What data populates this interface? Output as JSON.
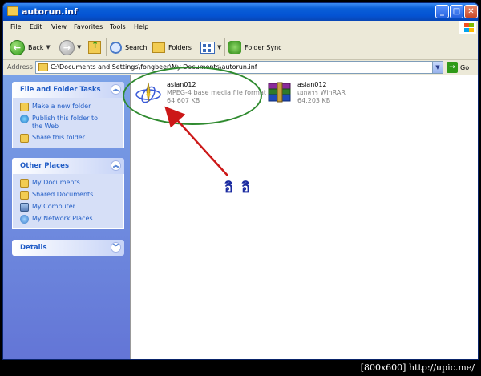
{
  "window": {
    "title": "autorun.inf"
  },
  "menu": [
    "File",
    "Edit",
    "View",
    "Favorites",
    "Tools",
    "Help"
  ],
  "toolbar": {
    "back": "Back",
    "search": "Search",
    "folders": "Folders",
    "folder_sync": "Folder Sync"
  },
  "address": {
    "label": "Address",
    "path": "C:\\Documents and Settings\\fongbeer\\My Documents\\autorun.inf",
    "go": "Go"
  },
  "tasks": {
    "file_folder": {
      "title": "File and Folder Tasks",
      "items": [
        "Make a new folder",
        "Publish this folder to the Web",
        "Share this folder"
      ]
    },
    "other_places": {
      "title": "Other Places",
      "items": [
        "My Documents",
        "Shared Documents",
        "My Computer",
        "My Network Places"
      ]
    },
    "details": {
      "title": "Details"
    }
  },
  "files": [
    {
      "name": "asian012",
      "type": "MPEG-4 base media file format",
      "size": "64,607 KB",
      "icon": "media-file-icon"
    },
    {
      "name": "asian012",
      "type": "เอกสาร WinRAR",
      "size": "64,203 KB",
      "icon": "winrar-icon"
    }
  ],
  "annotation": {
    "text": "อิ อิ",
    "circle_color": "#2f8a2f",
    "arrow_color": "#cc1818"
  },
  "footer": {
    "text": "[800x600] http://upic.me/"
  },
  "colors": {
    "titlebar": "#0453d3",
    "taskpane": "#6375d6",
    "link": "#215dc6"
  }
}
